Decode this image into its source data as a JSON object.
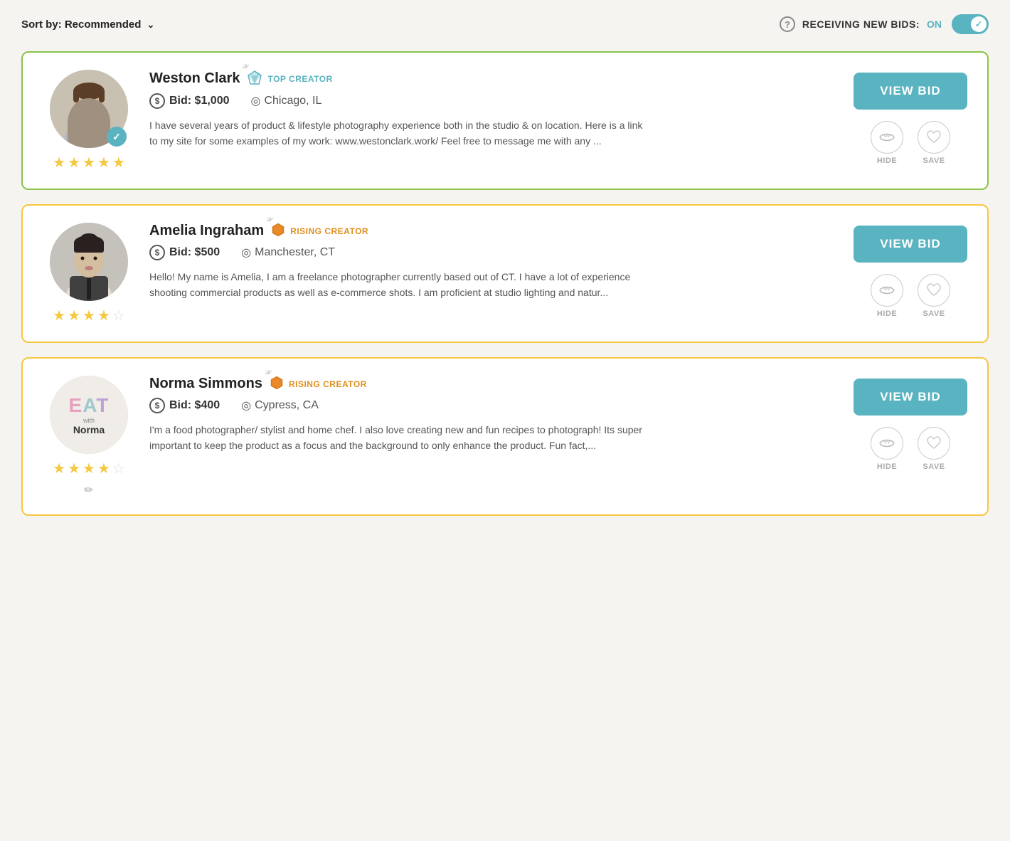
{
  "header": {
    "sort_label": "Sort by:",
    "sort_value": "Recommended",
    "help_icon": "?",
    "bids_label": "RECEIVING NEW BIDS:",
    "bids_status": "ON",
    "toggle_state": true
  },
  "creators": [
    {
      "id": "weston-clark",
      "name": "Weston Clark",
      "badge_type": "top",
      "badge_label": "TOP CREATOR",
      "bid": "Bid: $1,000",
      "location": "Chicago, IL",
      "bio": "I have several years of product & lifestyle photography experience both in the studio & on location. Here is a link to my site for some examples of my work: www.westonclark.work/ Feel free to message me with any ...",
      "stars": 5,
      "verified": true,
      "view_bid_label": "VIEW BID",
      "hide_label": "HIDE",
      "save_label": "SAVE",
      "card_border": "top"
    },
    {
      "id": "amelia-ingraham",
      "name": "Amelia Ingraham",
      "badge_type": "rising",
      "badge_label": "RISING CREATOR",
      "bid": "Bid: $500",
      "location": "Manchester, CT",
      "bio": "Hello! My name is Amelia, I am a freelance photographer currently based out of CT. I have a lot of experience shooting commercial products as well as e-commerce shots. I am proficient at studio lighting and natur...",
      "stars": 4,
      "verified": false,
      "view_bid_label": "VIEW BID",
      "hide_label": "HIDE",
      "save_label": "SAVE",
      "card_border": "rising"
    },
    {
      "id": "norma-simmons",
      "name": "Norma Simmons",
      "badge_type": "rising",
      "badge_label": "RISING CREATOR",
      "bid": "Bid: $400",
      "location": "Cypress, CA",
      "bio": "I'm a food photographer/ stylist and home chef. I also love creating new and fun recipes to photograph! Its super important to keep the product as a focus and the background to only enhance the product. Fun fact,...",
      "stars": 4,
      "verified": false,
      "view_bid_label": "VIEW BID",
      "hide_label": "HIDE",
      "save_label": "SAVE",
      "card_border": "rising",
      "is_logo": true,
      "logo_eat": "EAT",
      "logo_with": "with",
      "logo_name": "Norma"
    }
  ]
}
